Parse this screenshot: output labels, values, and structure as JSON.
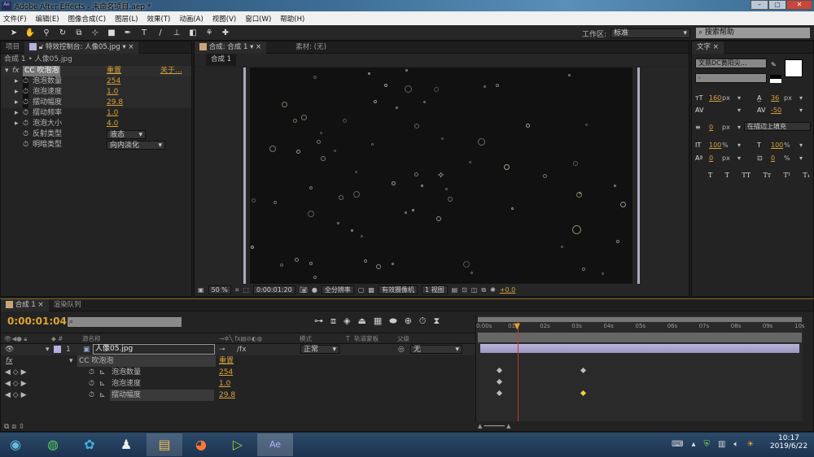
{
  "window": {
    "title": "Adobe After Effects - 未命名项目.aep *",
    "app_icon": "Ae"
  },
  "menu": [
    "文件(F)",
    "编辑(E)",
    "图像合成(C)",
    "图层(L)",
    "效果(T)",
    "动画(A)",
    "视图(V)",
    "窗口(W)",
    "帮助(H)"
  ],
  "toolbar": {
    "workspace_label": "工作区:",
    "workspace_value": "标准",
    "search_placeholder": "搜索帮助",
    "tools": [
      "selection-icon",
      "hand-icon",
      "zoom-icon",
      "rotate-icon",
      "camera-orbit-icon",
      "pan-behind-icon",
      "rectangle-icon",
      "pen-icon",
      "text-icon",
      "brush-icon",
      "clone-stamp-icon",
      "eraser-icon",
      "roto-brush-icon",
      "puppet-pin-icon"
    ]
  },
  "left_panel": {
    "tabs": [
      "项目",
      "特效控制台: 人像05.jpg"
    ],
    "breadcrumb": "合成 1 • 人像05.jpg",
    "effect": {
      "name": "CC 吹泡泡",
      "reset": "重置",
      "about": "关于..."
    },
    "params": [
      {
        "name": "泡泡数量",
        "value": "254",
        "keyed": true
      },
      {
        "name": "泡泡速度",
        "value": "1.0",
        "keyed": true
      },
      {
        "name": "摆动幅度",
        "value": "29.8",
        "keyed": true
      },
      {
        "name": "摆动频率",
        "value": "1.0",
        "keyed": false
      },
      {
        "name": "泡泡大小",
        "value": "4.0",
        "keyed": false
      },
      {
        "name": "反射类型",
        "value": "液态",
        "dropdown": true
      },
      {
        "name": "明暗类型",
        "value": "向内淡化",
        "dropdown": true
      }
    ]
  },
  "comp_panel": {
    "tabs": [
      "合成: 合成 1",
      "素材: (无)"
    ],
    "subtab": "合成 1",
    "footer": {
      "zoom": "50 %",
      "timecode": "0:00:01:20",
      "resolution": "全分辨率",
      "camera": "有效摄像机",
      "views": "1 视图",
      "exposure": "+0.0"
    }
  },
  "char_panel": {
    "tab": "文字",
    "font": "文鼎DC黄阳尖...",
    "style": "-",
    "size": "160",
    "size_unit": "px",
    "leading": "36",
    "leading_unit": "px",
    "tracking": "-50",
    "stroke": "0",
    "stroke_unit": "px",
    "stroke_mode": "在描边上填充",
    "vscale": "100",
    "hscale": "100",
    "pct": "%",
    "baseline": "0",
    "baseline_unit": "px",
    "tsume": "0",
    "style_buttons": [
      "T",
      "T",
      "TT",
      "Tт",
      "T¹",
      "T₁"
    ],
    "fill_color": "#ffffff"
  },
  "timeline": {
    "tabs": [
      "合成 1",
      "渲染队列"
    ],
    "timecode": "0:00:01:04",
    "headers": {
      "source": "源名称",
      "mode": "模式",
      "t": "T",
      "track": "轨道蒙板",
      "parent": "父级"
    },
    "layer": {
      "index": "1",
      "name": "人像05.jpg",
      "mode": "正常",
      "parent": "无",
      "color": "#b5b0e0"
    },
    "effect": {
      "name": "CC 吹泡泡",
      "reset": "重置"
    },
    "props": [
      {
        "name": "泡泡数量",
        "value": "254",
        "keyframes": [
          0.55,
          3.2
        ]
      },
      {
        "name": "泡泡速度",
        "value": "1.0",
        "keyframes": [
          0.55
        ]
      },
      {
        "name": "摆动幅度",
        "value": "29.8",
        "keyframes": [
          0.55,
          3.2
        ],
        "selected_keyframe": 3.2
      }
    ],
    "ruler": [
      "0:00s",
      "01s",
      "02s",
      "03s",
      "04s",
      "05s",
      "06s",
      "07s",
      "08s",
      "09s",
      "10s"
    ],
    "current_time_s": 1.16
  },
  "taskbar": {
    "apps": [
      "start-orb-icon",
      "360-browser-icon",
      "video-player-icon",
      "qq-icon",
      "file-explorer-icon",
      "firefox-icon",
      "media-app-icon",
      "after-effects-icon"
    ],
    "time": "10:17",
    "date": "2019/6/22"
  }
}
